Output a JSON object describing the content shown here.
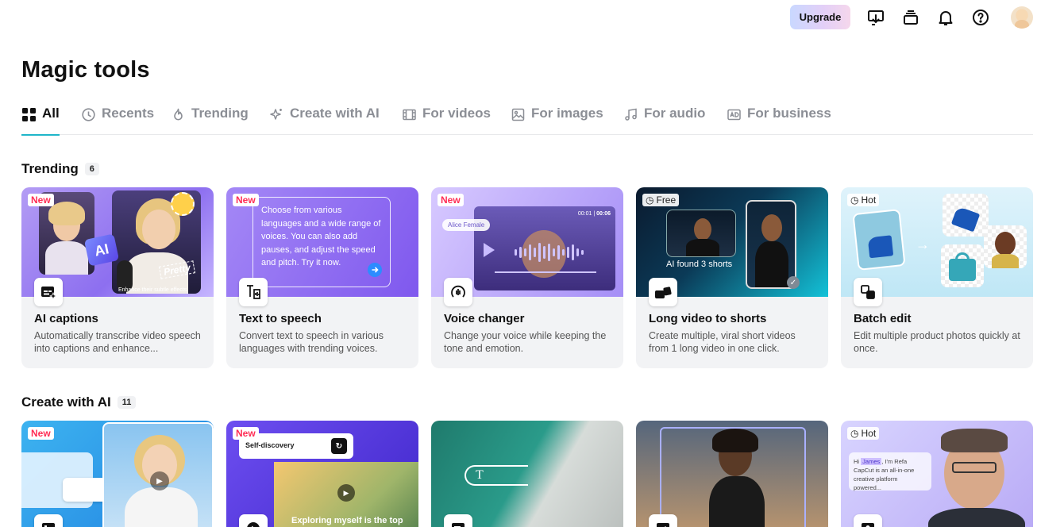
{
  "topbar": {
    "upgrade_label": "Upgrade",
    "icons": [
      "download-screen-icon",
      "stack-icon",
      "bell-icon",
      "help-icon",
      "avatar"
    ]
  },
  "page": {
    "title": "Magic tools"
  },
  "tabs": [
    {
      "label": "All",
      "icon": "grid-icon",
      "active": true
    },
    {
      "label": "Recents",
      "icon": "clock-icon"
    },
    {
      "label": "Trending",
      "icon": "flame-icon"
    },
    {
      "label": "Create with AI",
      "icon": "sparkle-icon"
    },
    {
      "label": "For videos",
      "icon": "film-icon"
    },
    {
      "label": "For images",
      "icon": "image-icon"
    },
    {
      "label": "For audio",
      "icon": "music-icon"
    },
    {
      "label": "For business",
      "icon": "ad-icon"
    }
  ],
  "trending": {
    "title": "Trending",
    "count": "6",
    "cards": [
      {
        "name": "AI captions",
        "desc": "Automatically transcribe video speech into captions and enhance...",
        "badge": "New",
        "ai_tag": "AI",
        "caption_tag": "Pretty",
        "thumb_caption": "Enhance their subtle effects"
      },
      {
        "name": "Text to speech",
        "desc": "Convert text to speech in various languages with trending voices.",
        "badge": "New",
        "thumb_text": "Choose from various languages and a wide range of voices. You can also add pauses, and adjust the speed and pitch. Try it now."
      },
      {
        "name": "Voice changer",
        "desc": "Change your voice while keeping the tone and emotion.",
        "badge": "New",
        "voice_chip": "Alice Female",
        "time_a": "00:01",
        "time_b": "00:06"
      },
      {
        "name": "Long video to shorts",
        "desc": "Create multiple, viral short videos from 1 long video in one click.",
        "badge": "Free",
        "thumb_caption": "AI found 3 shorts"
      },
      {
        "name": "Batch edit",
        "desc": "Edit multiple product photos quickly at once.",
        "badge": "Hot"
      }
    ]
  },
  "create_ai": {
    "title": "Create with AI",
    "count": "11",
    "cards": [
      {
        "badge": "New"
      },
      {
        "badge": "New",
        "chip": "Self-discovery",
        "overlay": "Exploring myself is the top"
      },
      {
        "text_tag": "T"
      },
      {},
      {
        "badge": "Hot",
        "script_line_1_prefix": "Hi ",
        "script_name": "James",
        "script_line_1_suffix": ", I'm Refa",
        "script_line_2": "CapCut is an all-in-one",
        "script_line_3": "creative platform powered..."
      }
    ]
  },
  "colors": {
    "accent": "#1fb6c9",
    "new_badge": "#ff2d55"
  }
}
